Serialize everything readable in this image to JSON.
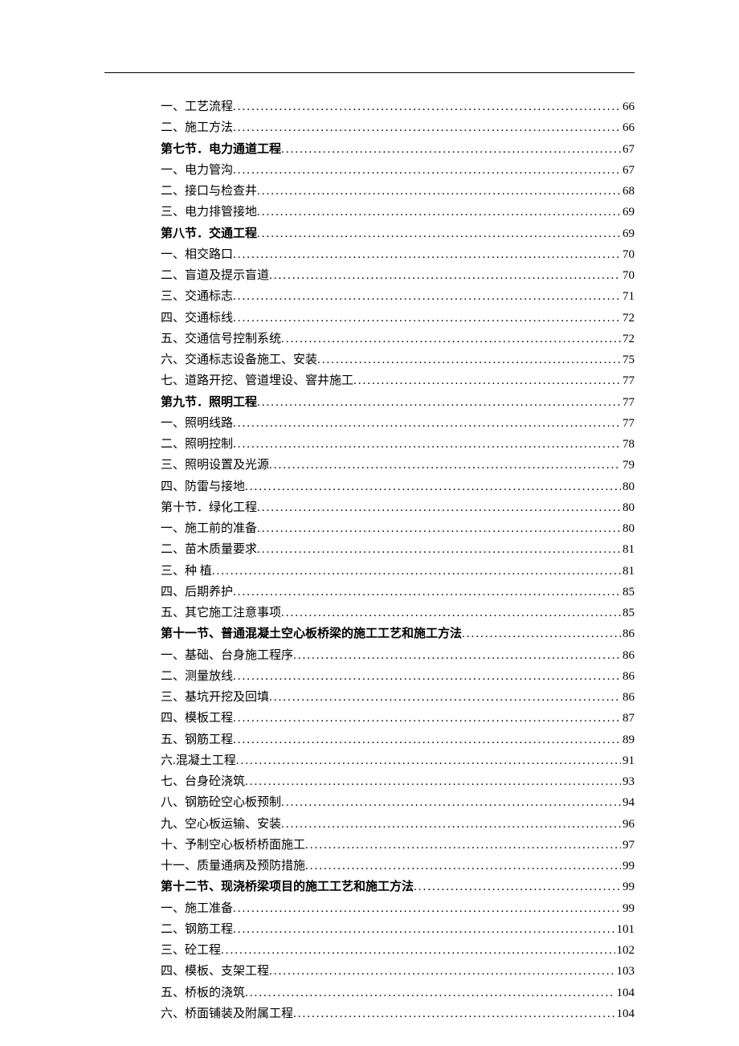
{
  "toc": [
    {
      "label": "一、工艺流程",
      "page": "66",
      "bold": false
    },
    {
      "label": "二、施工方法",
      "page": "66",
      "bold": false
    },
    {
      "label": "第七节．电力通道工程",
      "page": "67",
      "bold": true
    },
    {
      "label": "一、电力管沟",
      "page": "67",
      "bold": false
    },
    {
      "label": "二、接口与检查井",
      "page": "68",
      "bold": false
    },
    {
      "label": "三、电力排管接地",
      "page": "69",
      "bold": false
    },
    {
      "label": "第八节．交通工程",
      "page": "69",
      "bold": true
    },
    {
      "label": "一、相交路口",
      "page": "70",
      "bold": false
    },
    {
      "label": "二、盲道及提示盲道",
      "page": "70",
      "bold": false
    },
    {
      "label": "三、交通标志",
      "page": "71",
      "bold": false
    },
    {
      "label": "四、交通标线",
      "page": "72",
      "bold": false
    },
    {
      "label": "五、交通信号控制系统",
      "page": "72",
      "bold": false
    },
    {
      "label": "六、交通标志设备施工、安装",
      "page": "75",
      "bold": false
    },
    {
      "label": "七、道路开挖、管道埋设、窨井施工",
      "page": "77",
      "bold": false
    },
    {
      "label": "第九节．照明工程",
      "page": "77",
      "bold": true
    },
    {
      "label": "一、照明线路",
      "page": "77",
      "bold": false
    },
    {
      "label": "二、照明控制",
      "page": "78",
      "bold": false
    },
    {
      "label": "三、照明设置及光源",
      "page": "79",
      "bold": false
    },
    {
      "label": "四、防雷与接地",
      "page": "80",
      "bold": false
    },
    {
      "label": "第十节．绿化工程",
      "page": "80",
      "bold": false
    },
    {
      "label": "一、施工前的准备",
      "page": "80",
      "bold": false
    },
    {
      "label": "二、苗木质量要求",
      "page": "81",
      "bold": false
    },
    {
      "label": "三、种 植",
      "page": "81",
      "bold": false
    },
    {
      "label": "四、后期养护",
      "page": "85",
      "bold": false
    },
    {
      "label": "五、其它施工注意事项",
      "page": "85",
      "bold": false
    },
    {
      "label": "第十一节、普通混凝土空心板桥梁的施工工艺和施工方法",
      "page": "86",
      "bold": true
    },
    {
      "label": "一、基础、台身施工程序",
      "page": "86",
      "bold": false
    },
    {
      "label": "二、测量放线",
      "page": "86",
      "bold": false
    },
    {
      "label": "三、基坑开挖及回填",
      "page": "86",
      "bold": false
    },
    {
      "label": "四、模板工程",
      "page": "87",
      "bold": false
    },
    {
      "label": "五、钢筋工程",
      "page": "89",
      "bold": false
    },
    {
      "label": "六.混凝土工程",
      "page": "91",
      "bold": false
    },
    {
      "label": "七、台身砼浇筑",
      "page": "93",
      "bold": false
    },
    {
      "label": "八、钢筋砼空心板预制",
      "page": "94",
      "bold": false
    },
    {
      "label": "九、空心板运输、安装",
      "page": "96",
      "bold": false
    },
    {
      "label": "十、予制空心板桥桥面施工",
      "page": "97",
      "bold": false
    },
    {
      "label": "十一、质量通病及预防措施",
      "page": "99",
      "bold": false
    },
    {
      "label": "第十二节、现浇桥梁项目的施工工艺和施工方法",
      "page": "99",
      "bold": true
    },
    {
      "label": "一、施工准备",
      "page": "99",
      "bold": false
    },
    {
      "label": "二、钢筋工程",
      "page": "101",
      "bold": false
    },
    {
      "label": "三、砼工程",
      "page": "102",
      "bold": false
    },
    {
      "label": "四、模板、支架工程",
      "page": "103",
      "bold": false
    },
    {
      "label": "五、桥板的浇筑",
      "page": "104",
      "bold": false
    },
    {
      "label": "六、桥面铺装及附属工程",
      "page": "104",
      "bold": false
    }
  ]
}
